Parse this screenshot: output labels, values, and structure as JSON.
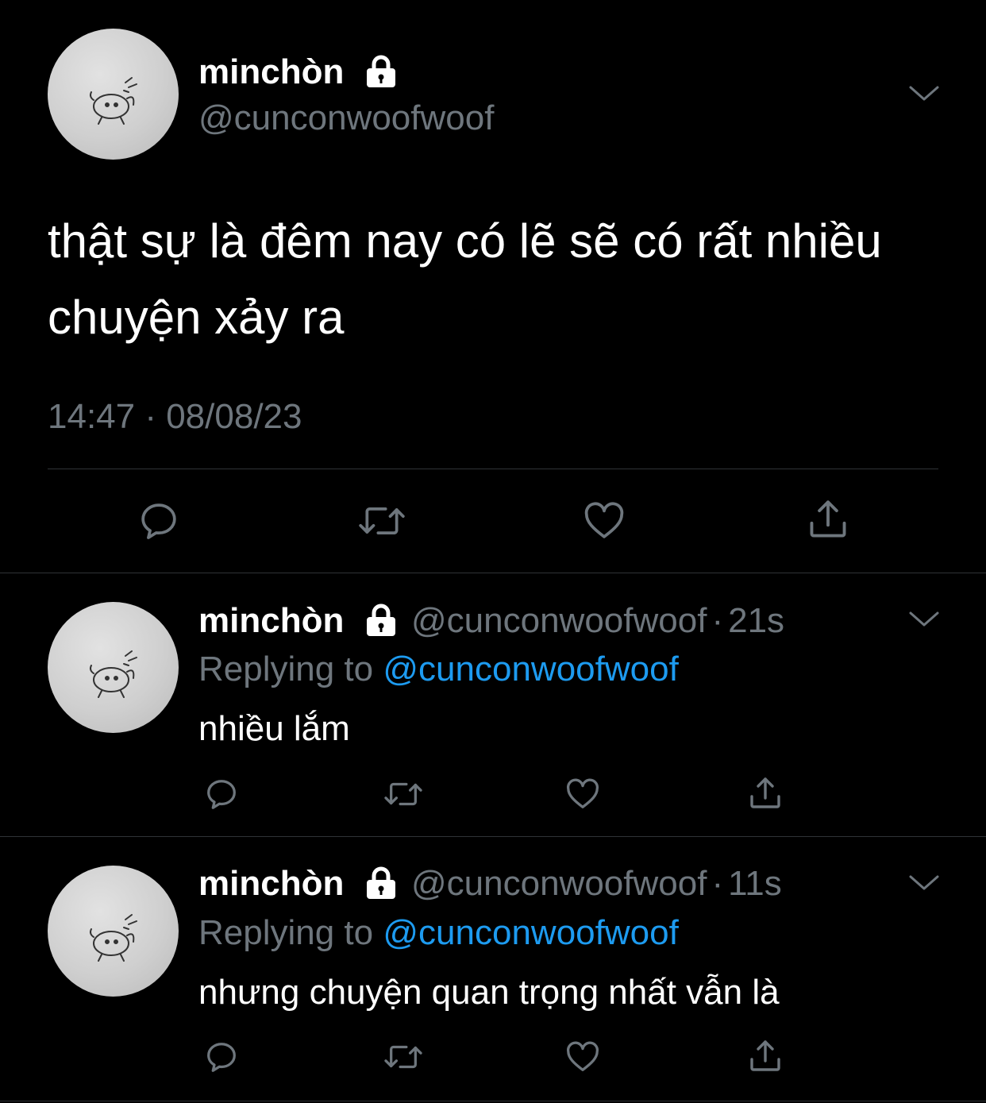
{
  "main_tweet": {
    "display_name": "minchòn",
    "handle": "@cunconwoofwoof",
    "text": "thật sự là đêm nay có lẽ sẽ có rất nhiều chuyện xảy ra",
    "timestamp": "14:47 · 08/08/23"
  },
  "replies": [
    {
      "display_name": "minchòn",
      "handle": "@cunconwoofwoof",
      "separator": "·",
      "time": "21s",
      "replying_prefix": "Replying to",
      "replying_to": "@cunconwoofwoof",
      "text": "nhiều lắm"
    },
    {
      "display_name": "minchòn",
      "handle": "@cunconwoofwoof",
      "separator": "·",
      "time": "11s",
      "replying_prefix": "Replying to",
      "replying_to": "@cunconwoofwoof",
      "text": "nhưng chuyện quan trọng nhất vẫn là"
    }
  ],
  "icons": {
    "reply": "reply-icon",
    "retweet": "retweet-icon",
    "like": "like-icon",
    "share": "share-icon",
    "lock": "lock-icon",
    "more": "chevron-down-icon"
  },
  "colors": {
    "background": "#000000",
    "text": "#ffffff",
    "secondary": "#6e767d",
    "link": "#1d9bf0",
    "divider": "#2f3336"
  }
}
